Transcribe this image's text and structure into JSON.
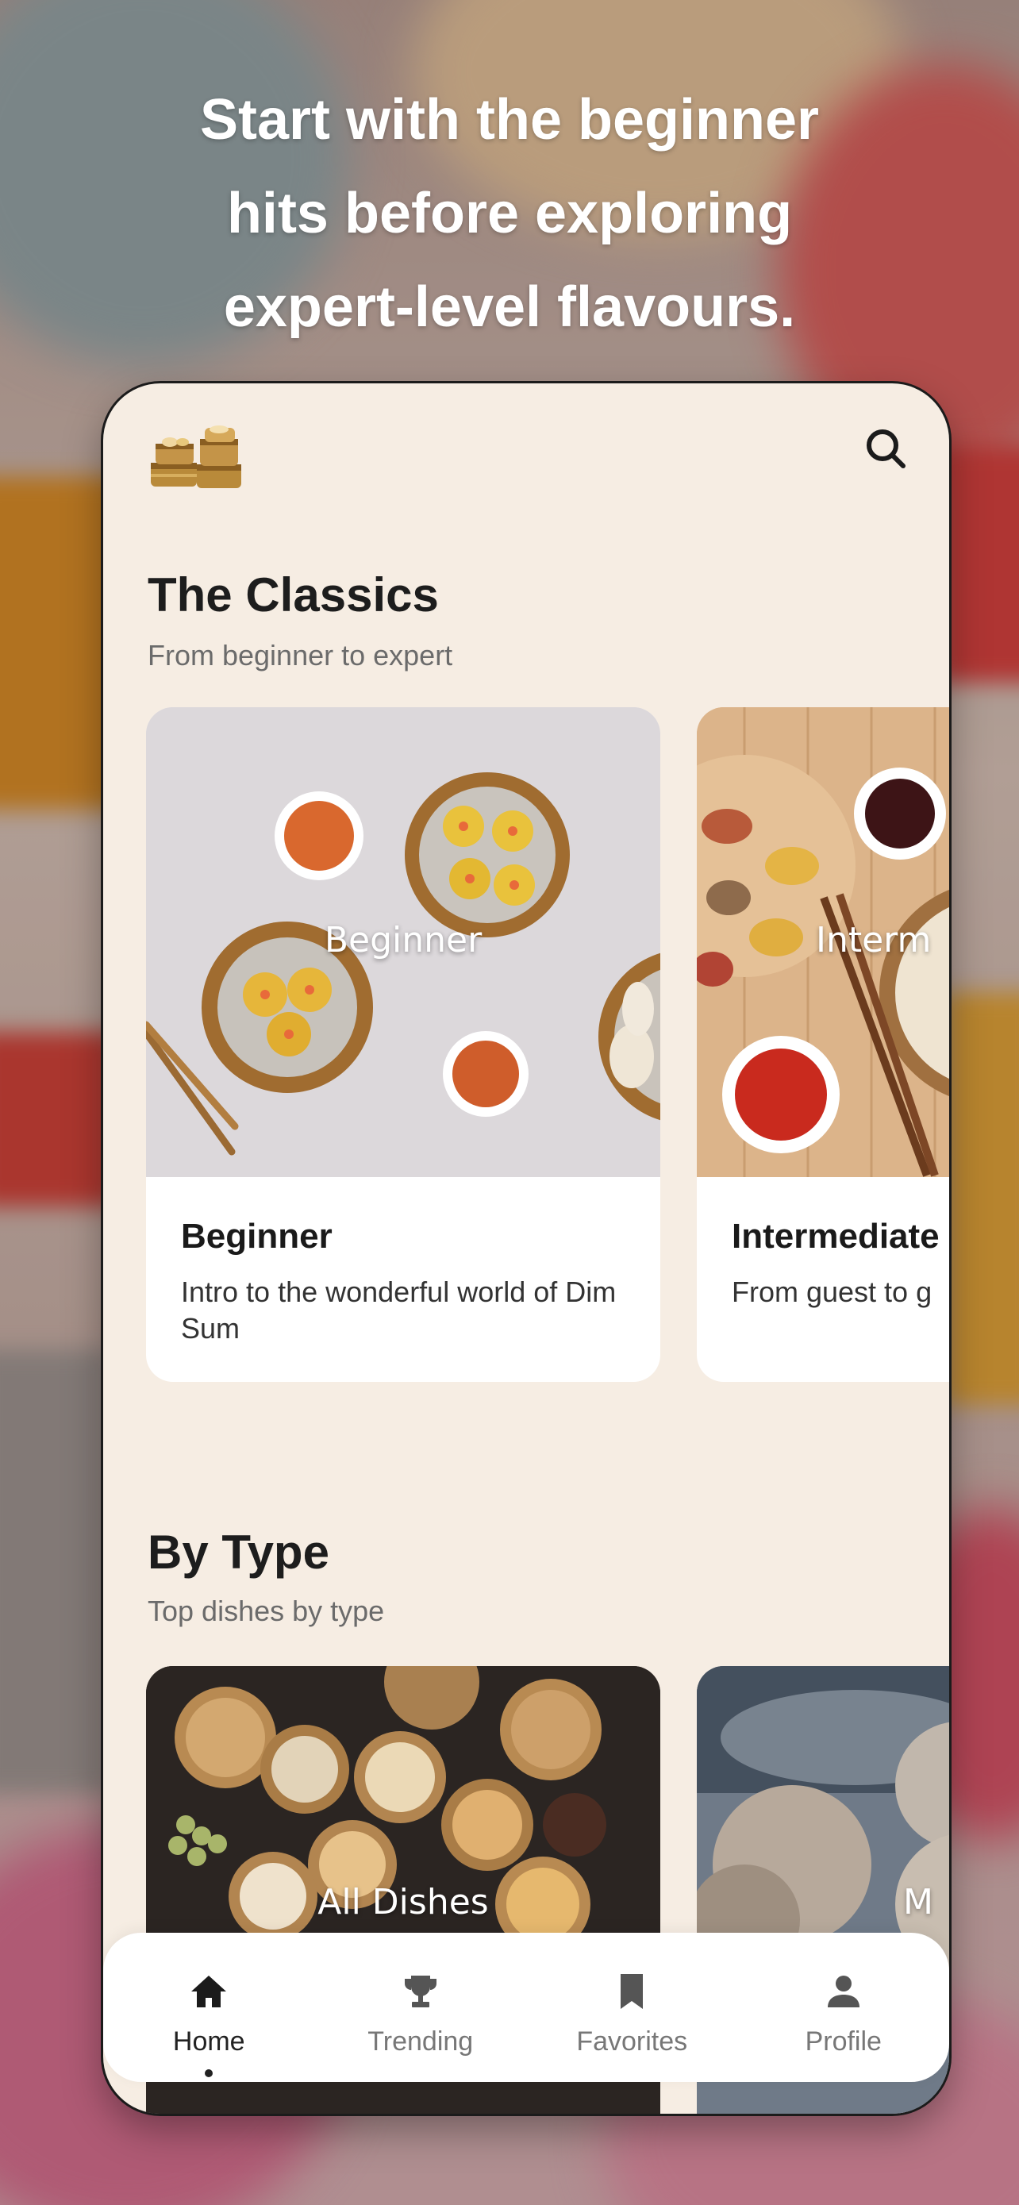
{
  "headline": {
    "line1": "Start with the beginner",
    "line2": "hits before exploring",
    "line3": "expert-level flavours."
  },
  "header": {
    "logo_icon": "steamer-baskets-logo-icon",
    "search_icon": "search-icon"
  },
  "classics": {
    "title": "The Classics",
    "subtitle": "From beginner to expert",
    "cards": [
      {
        "overlay": "Beginner",
        "title": "Beginner",
        "description": "Intro to the wonderful world of Dim Sum"
      },
      {
        "overlay": "Interm",
        "title": "Intermediate",
        "description": "From guest to g"
      }
    ]
  },
  "by_type": {
    "title": "By Type",
    "subtitle": "Top dishes by type",
    "cards": [
      {
        "overlay": "All Dishes"
      },
      {
        "overlay": "M"
      }
    ]
  },
  "nav": {
    "items": [
      {
        "label": "Home",
        "icon": "home-icon",
        "active": true
      },
      {
        "label": "Trending",
        "icon": "trophy-icon",
        "active": false
      },
      {
        "label": "Favorites",
        "icon": "bookmark-icon",
        "active": false
      },
      {
        "label": "Profile",
        "icon": "person-icon",
        "active": false
      }
    ]
  },
  "colors": {
    "app_background": "#f6ede3",
    "card_background": "#ffffff",
    "text_primary": "#1d1d1d",
    "text_secondary": "#6b6b6b"
  }
}
